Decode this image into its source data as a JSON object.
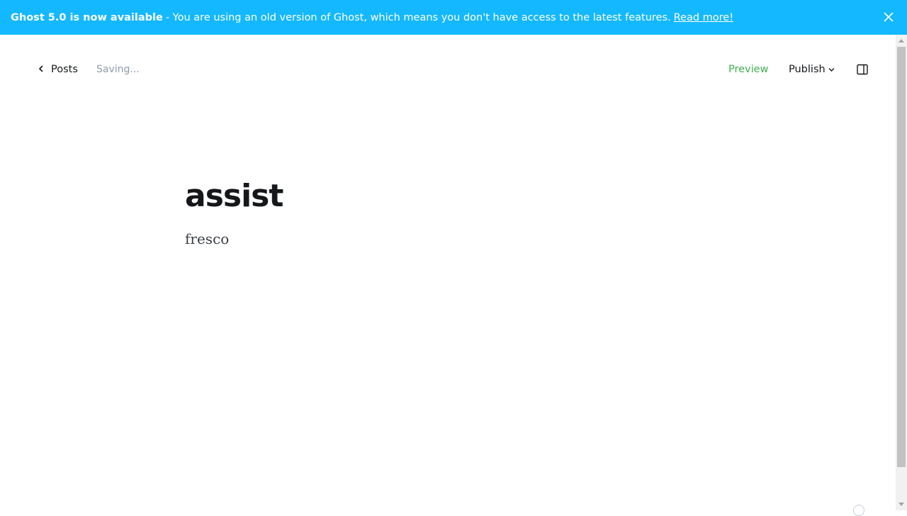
{
  "banner": {
    "headline": "Ghost 5.0 is now available",
    "message": "- You are using an old version of Ghost, which means you don't have access to the latest features.",
    "link_label": "Read more!",
    "close_icon": "close-icon",
    "background_color": "#14b8ff"
  },
  "header": {
    "back_label": "Posts",
    "back_icon": "chevron-left-icon",
    "status": "Saving...",
    "preview_label": "Preview",
    "publish_label": "Publish",
    "publish_icon": "chevron-down-icon",
    "sidebar_toggle_icon": "sidebar-toggle-icon",
    "preview_color": "#3eb050"
  },
  "editor": {
    "title": "assist",
    "body": "fresco"
  }
}
